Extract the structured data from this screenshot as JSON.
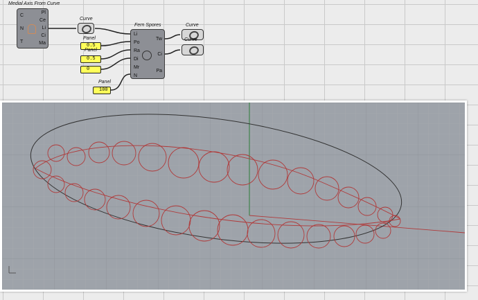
{
  "canvas": {
    "components": {
      "medial_axis": {
        "title": "Medial Axis From Curve",
        "inputs": [
          "C",
          "N",
          "T"
        ],
        "outputs": [
          "Pl",
          "Ce",
          "Li",
          "Ci",
          "Ma"
        ]
      },
      "curve_param_1": {
        "title": "Curve"
      },
      "fern_spores": {
        "title": "Fern Spores",
        "inputs": [
          "Li",
          "Po",
          "Ra",
          "Di",
          "Mr",
          "N"
        ],
        "outputs": [
          "Tw",
          "Ci",
          "Pa"
        ]
      },
      "curve_param_2": {
        "title": "Curve"
      },
      "curve_param_3": {
        "title": "Curve"
      }
    },
    "panels": [
      {
        "title": "Panel",
        "value": "0.5"
      },
      {
        "title": "Panel",
        "value": "0.5"
      },
      {
        "title": "",
        "value": "0"
      },
      {
        "title": "Panel",
        "value": "100"
      }
    ]
  },
  "viewport": {
    "background": "#9ea3aa",
    "boundary_curve_color": "#333333",
    "circle_color": "#b03a3a",
    "axis_color": "#c0392b"
  }
}
